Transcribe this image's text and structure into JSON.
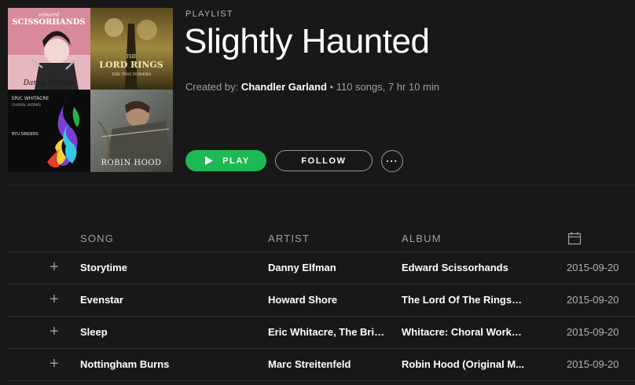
{
  "header": {
    "type_label": "PLAYLIST",
    "title": "Slightly Haunted",
    "created_by_label": "Created by:",
    "owner": "Chandler Garland",
    "summary": "• 110 songs, 7 hr 10 min"
  },
  "cover": {
    "tile_1": {
      "line1": "edward",
      "line2": "SCISSORHANDS",
      "line3": "Danny Elfman"
    },
    "tile_2": {
      "line1": "THE",
      "line2": "LORD RINGS",
      "line3": "THE TWO TOWERS"
    },
    "tile_3": {
      "line1": "ERIC WHITACRE",
      "line2": "CHORAL WORKS",
      "line3": "BYU SINGERS"
    },
    "tile_4": {
      "line1": "ROBIN HOOD"
    }
  },
  "actions": {
    "play_label": "PLAY",
    "follow_label": "FOLLOW",
    "more_label": "···"
  },
  "table": {
    "columns": {
      "song": "SONG",
      "artist": "ARTIST",
      "album": "ALBUM",
      "date_icon": "calendar-icon"
    },
    "rows": [
      {
        "song": "Storytime",
        "artist": "Danny Elfman",
        "album": "Edward Scissorhands",
        "date": "2015-09-20"
      },
      {
        "song": "Evenstar",
        "artist": "Howard Shore",
        "album": "The Lord Of The Rings: ...",
        "date": "2015-09-20"
      },
      {
        "song": "Sleep",
        "artist": "Eric Whitacre, The Brigh...",
        "album": "Whitacre: Choral Works,...",
        "date": "2015-09-20"
      },
      {
        "song": "Nottingham Burns",
        "artist": "Marc Streitenfeld",
        "album": "Robin Hood (Original M...",
        "date": "2015-09-20"
      }
    ]
  },
  "colors": {
    "background": "#181818",
    "accent": "#1db954",
    "muted_text": "#b3b3b3"
  }
}
